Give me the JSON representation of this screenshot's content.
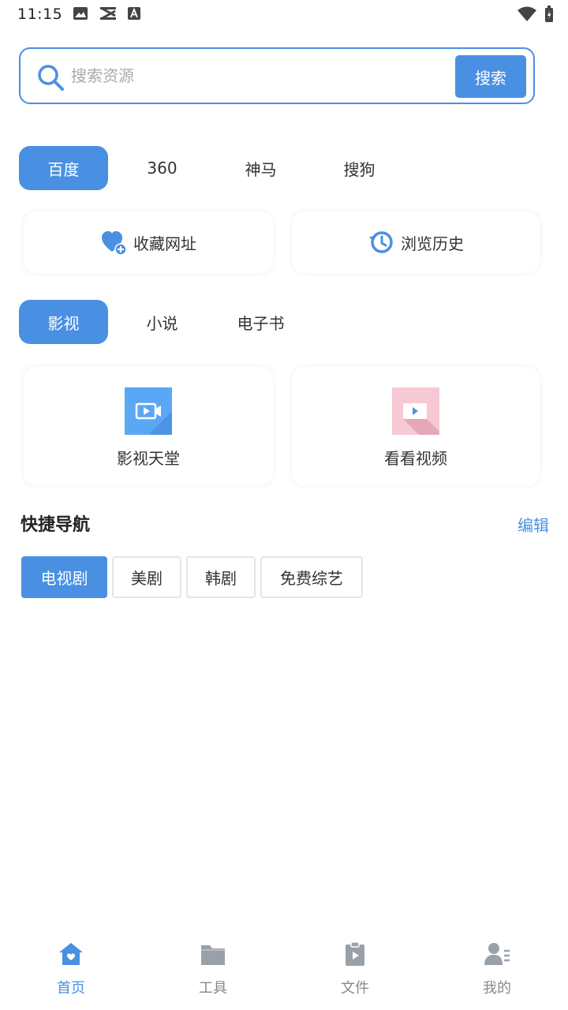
{
  "status_bar": {
    "time": "11:15",
    "left_icons": [
      "image-icon",
      "capcut-icon",
      "font-icon"
    ],
    "right_icons": [
      "wifi-icon",
      "battery-icon"
    ]
  },
  "search": {
    "placeholder": "搜索资源",
    "value": "",
    "button_label": "搜索"
  },
  "engine_tabs": [
    {
      "label": "百度",
      "active": true
    },
    {
      "label": "360",
      "active": false
    },
    {
      "label": "神马",
      "active": false
    },
    {
      "label": "搜狗",
      "active": false
    }
  ],
  "quick_links": [
    {
      "label": "收藏网址",
      "icon": "heart-plus-icon"
    },
    {
      "label": "浏览历史",
      "icon": "history-icon"
    }
  ],
  "category_tabs": [
    {
      "label": "影视",
      "active": true
    },
    {
      "label": "小说",
      "active": false
    },
    {
      "label": "电子书",
      "active": false
    }
  ],
  "sites": [
    {
      "label": "影视天堂",
      "icon": "video-camera-icon"
    },
    {
      "label": "看看视频",
      "icon": "video-player-icon"
    }
  ],
  "quick_nav": {
    "title": "快捷导航",
    "edit_label": "编辑",
    "chips": [
      {
        "label": "电视剧",
        "active": true
      },
      {
        "label": "美剧",
        "active": false
      },
      {
        "label": "韩剧",
        "active": false
      },
      {
        "label": "免费综艺",
        "active": false
      }
    ]
  },
  "bottom_nav": [
    {
      "label": "首页",
      "icon": "home-icon",
      "active": true
    },
    {
      "label": "工具",
      "icon": "folder-icon",
      "active": false
    },
    {
      "label": "文件",
      "icon": "file-icon",
      "active": false
    },
    {
      "label": "我的",
      "icon": "profile-icon",
      "active": false
    }
  ],
  "colors": {
    "accent": "#4a90e2",
    "inactive": "#888888",
    "pink_tile": "#f7c9d4",
    "blue_tile": "#5aa7f5"
  }
}
